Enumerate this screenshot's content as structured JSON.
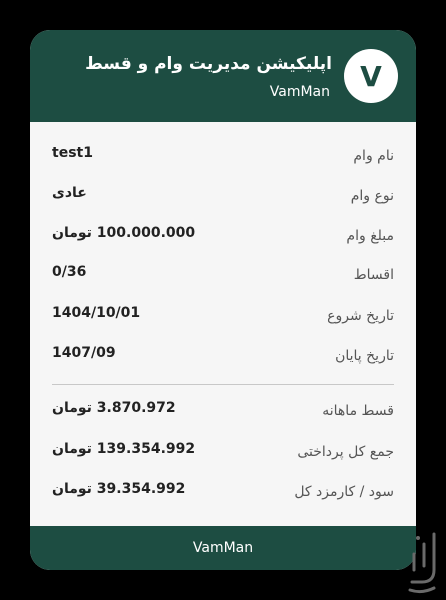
{
  "header": {
    "logo_letter": "V",
    "title": "اپلیکیشن مدیریت وام و قسط",
    "subtitle": "VamMan"
  },
  "details": [
    {
      "label": "نام وام",
      "value": "test1"
    },
    {
      "label": "نوع وام",
      "value": "عادی"
    },
    {
      "label": "مبلغ وام",
      "value": "100.000.000 تومان"
    },
    {
      "label": "اقساط",
      "value": "0/36"
    },
    {
      "label": "تاریخ شروع",
      "value": "1404/10/01"
    },
    {
      "label": "تاریخ پایان",
      "value": "1407/09"
    }
  ],
  "summary": [
    {
      "label": "قسط ماهانه",
      "value": "3.870.972 تومان"
    },
    {
      "label": "جمع کل پرداختی",
      "value": "139.354.992 تومان"
    },
    {
      "label": "سود / کارمزد کل",
      "value": "39.354.992 تومان"
    }
  ],
  "footer": {
    "label": "VamMan"
  },
  "colors": {
    "primary": "#1d4d42",
    "card_background": "#f6f6f6",
    "page_background": "#000000"
  },
  "icons": {
    "logo": "letter-v-logo",
    "watermark": "bazaar-logo-icon"
  }
}
